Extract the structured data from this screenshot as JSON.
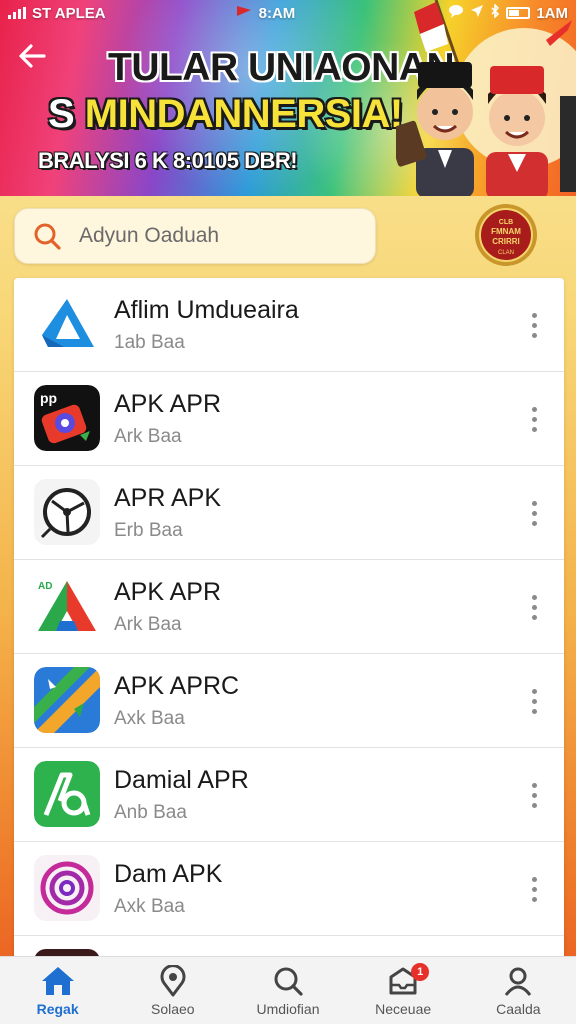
{
  "status_bar": {
    "carrier": "ST APLEA",
    "time": "8:AM",
    "battery_label": "1AM"
  },
  "banner": {
    "back_icon": "arrow-left-icon",
    "title_line1": "TULAR UNIAONAN",
    "title_line2_prefix": "S ",
    "title_line2_highlight": "MINDANNERSIA!",
    "subtitle": "BRALYSI 6 K 8:0105 DBR!",
    "badge_text_1": "CLB",
    "badge_text_2": "FMNAM",
    "badge_text_3": "CRIRRI",
    "badge_text_4": "CLAN"
  },
  "search": {
    "placeholder": "Adyun Oaduah",
    "icon": "search-icon"
  },
  "apps": [
    {
      "name": "Aflim Umdueaira",
      "subtitle": "1ab Baa",
      "icon": "blue-triangle-app-icon"
    },
    {
      "name": "APK APR",
      "subtitle": "Ark Baa",
      "icon": "dark-camera-app-icon"
    },
    {
      "name": "APR APK",
      "subtitle": "Erb Baa",
      "icon": "wheel-app-icon"
    },
    {
      "name": "APK APR",
      "subtitle": "Ark Baa",
      "icon": "color-triangle-app-icon"
    },
    {
      "name": "APK APRC",
      "subtitle": "Axk Baa",
      "icon": "map-app-icon"
    },
    {
      "name": "Damial APR",
      "subtitle": "Anb Baa",
      "icon": "green-a-app-icon"
    },
    {
      "name": "Dam APK",
      "subtitle": "Axk Baa",
      "icon": "purple-spiral-app-icon"
    }
  ],
  "bottom_nav": [
    {
      "label": "Regak",
      "icon": "home-icon",
      "active": true
    },
    {
      "label": "Solaeo",
      "icon": "location-pin-icon",
      "active": false
    },
    {
      "label": "Umdiofian",
      "icon": "search-icon",
      "active": false
    },
    {
      "label": "Neceuae",
      "icon": "inbox-icon",
      "active": false,
      "badge": "1"
    },
    {
      "label": "Caalda",
      "icon": "user-icon",
      "active": false
    }
  ],
  "colors": {
    "accent": "#1f6fd1",
    "notification": "#e8302a"
  }
}
